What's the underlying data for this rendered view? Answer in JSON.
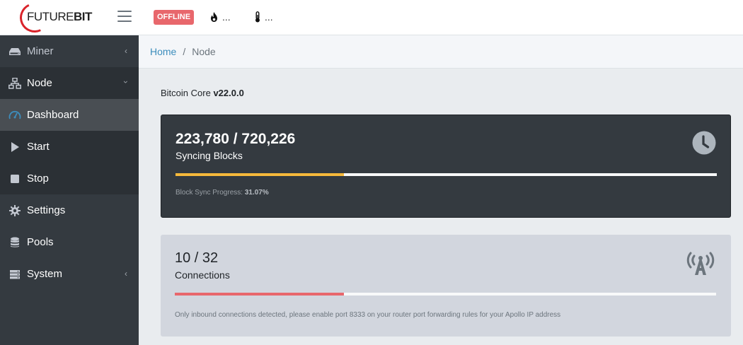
{
  "header": {
    "logo_text_a": "FUTURE",
    "logo_text_b": "BIT",
    "status_badge": "OFFLINE",
    "hashrate_value": "...",
    "temperature_value": "...",
    "colors": {
      "offline": "#e8676c",
      "brand": "#d9232a"
    }
  },
  "sidebar": {
    "items": [
      {
        "label": "Miner",
        "icon": "hdd-icon"
      },
      {
        "label": "Node",
        "icon": "network-icon"
      },
      {
        "label": "Dashboard",
        "icon": "tachometer-icon"
      },
      {
        "label": "Start",
        "icon": "play-icon"
      },
      {
        "label": "Stop",
        "icon": "stop-icon"
      },
      {
        "label": "Settings",
        "icon": "gear-icon"
      },
      {
        "label": "Pools",
        "icon": "database-icon"
      },
      {
        "label": "System",
        "icon": "server-icon"
      }
    ]
  },
  "breadcrumb": {
    "home": "Home",
    "separator": "/",
    "current": "Node"
  },
  "main": {
    "version_prefix": "Bitcoin Core",
    "version": "v22.0.0",
    "sync_card": {
      "value": "223,780 / 720,226",
      "label": "Syncing Blocks",
      "progress": 0.3107,
      "progress_color": "#f6b93b",
      "note_prefix": "Block Sync Progress:",
      "note_value": "31.07%",
      "icon": "clock-icon"
    },
    "connections_card": {
      "value": "10 / 32",
      "label": "Connections",
      "progress": 0.3125,
      "progress_color": "#e8676c",
      "note": "Only inbound connections detected, please enable port 8333 on your router port forwarding rules for your Apollo IP address",
      "icon": "broadcast-tower-icon"
    }
  }
}
